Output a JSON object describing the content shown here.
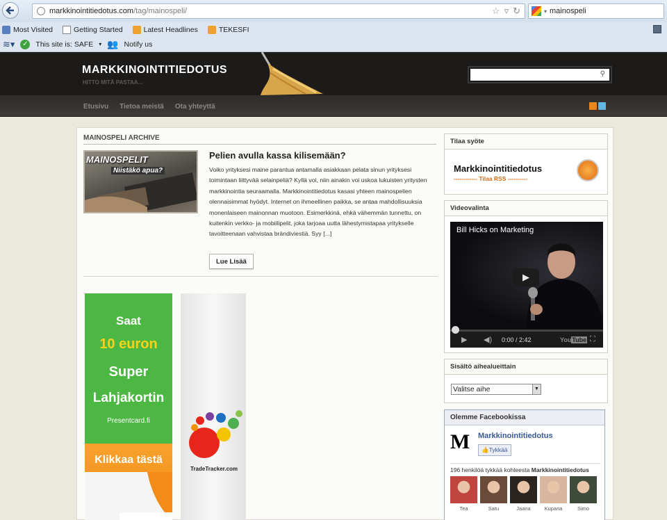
{
  "browser": {
    "url_host": "markkinointitiedotus.com",
    "url_path": "/tag/mainospeli/",
    "search_value": "mainospeli",
    "bookmarks": [
      "Most Visited",
      "Getting Started",
      "Latest Headlines",
      "TEKESFI"
    ],
    "safe_label": "This site is: SAFE",
    "notify_label": "Notify us"
  },
  "site": {
    "title": "MARKKINOINTITIEDOTUS",
    "tagline": "HITTO MITÄ PASTAA...",
    "nav": [
      "Etusivu",
      "Tietoa meistä",
      "Ota yhteyttä"
    ]
  },
  "archive": {
    "heading": "MAINOSPELI ARCHIVE",
    "post": {
      "image_text": "MAINOSPELIT",
      "image_subtext": "Niistäkö apua?",
      "title": "Pelien avulla kassa kilisemään?",
      "excerpt": "Voiko yrityksesi maine parantua antamalla asiakkaan pelata sinun yrityksesi toimintaan liittyvää selainpeliä? Kyllä voi, niin ainakin voi uskoa lukuisten yritysten markkinointia seuraamalla. Markkinointitiedotus kasasi yhteen mainospelien olennaisimmat hyödyt. Internet on ihmeellinen paikka, se antaa mahdollisuuksia monenlaiseen mainonnan muotoon. Esimerkkinä, ehkä vähemmän tunnettu, on kuitenkin verkko- ja mobiilipelit, joka tarjoaa uutta lähestymistapaa yritykselle tavoitteenaan vahvistaa brändiviestiä. Syy [...]",
      "read_more": "Lue Lisää"
    }
  },
  "ads": {
    "presentcard": {
      "line1": "Saat",
      "line2": "10 euron",
      "line3": "Super",
      "line4": "Lahjakortin",
      "domain": "Presentcard.fi",
      "cta": "Klikkaa tästä"
    },
    "tradetracker": {
      "label": "TradeTracker.com"
    }
  },
  "sidebar": {
    "subscribe": {
      "heading": "Tilaa syöte",
      "title": "Markkinointitiedotus",
      "sub": "------------ Tilaa RSS ----------"
    },
    "video": {
      "heading": "Videovalinta",
      "title": "Bill Hicks on Marketing",
      "time": "0:00 / 2:42",
      "progress": 0.0
    },
    "topics": {
      "heading": "Sisältö aihealueittain",
      "selected": "Valitse aihe"
    },
    "facebook": {
      "heading": "Olemme Facebookissa",
      "page_name": "Markkinointitiedotus",
      "like_label": "Tykkää",
      "count_prefix": "196 henkilöä tykkää kohteesta",
      "count_name": "Markkinointitiedotus",
      "faces": [
        {
          "name": "Tea",
          "color": "#c0453e"
        },
        {
          "name": "Satu",
          "color": "#6a4a38"
        },
        {
          "name": "Jaana",
          "color": "#2b2320"
        },
        {
          "name": "Kupana",
          "color": "#d9b6a0"
        },
        {
          "name": "Simo",
          "color": "#3e4a3a"
        }
      ]
    }
  }
}
